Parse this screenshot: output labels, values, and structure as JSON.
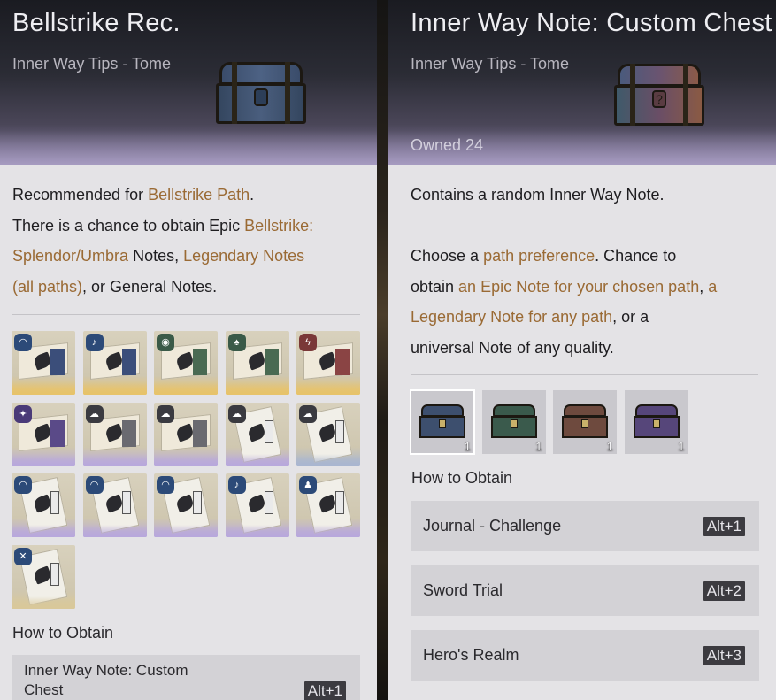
{
  "left_panel": {
    "title": "Bellstrike Rec.",
    "subtitle": "Inner Way Tips - Tome",
    "description": {
      "line1_prefix": "Recommended for ",
      "line1_highlight": "Bellstrike Path",
      "line1_suffix": ".",
      "line2_prefix": "There is a chance to obtain Epic ",
      "line2_highlight": "Bellstrike:",
      "line3_highlight": "Splendor/Umbra",
      "line3_mid": " Notes, ",
      "line3_highlight2": "Legendary Notes",
      "line4_highlight": "(all paths)",
      "line4_suffix": ", or General Notes."
    },
    "note_icons": [
      {
        "icon": "wave-badge-note-icon",
        "badge": "◠",
        "badge_color": "#2c4a78",
        "strip_color": "#3b4e7a",
        "glow": "#e7c36a",
        "style": "scroll"
      },
      {
        "icon": "swirl-badge-note-icon",
        "badge": "♪",
        "badge_color": "#2c4a78",
        "strip_color": "#3b4e7a",
        "glow": "#e7c36a",
        "style": "scroll"
      },
      {
        "icon": "seal-badge-note-icon",
        "badge": "◉",
        "badge_color": "#3a5a48",
        "strip_color": "#4a6a52",
        "glow": "#e7c36a",
        "style": "scroll"
      },
      {
        "icon": "drop-badge-note-icon",
        "badge": "♠",
        "badge_color": "#3a5a48",
        "strip_color": "#4a6a52",
        "glow": "#e7c36a",
        "style": "scroll"
      },
      {
        "icon": "bolt-badge-note-icon",
        "badge": "ϟ",
        "badge_color": "#7a3838",
        "strip_color": "#8a4444",
        "glow": "#e7c36a",
        "style": "scroll"
      },
      {
        "icon": "flame-badge-note-icon",
        "badge": "✦",
        "badge_color": "#4a3a78",
        "strip_color": "#5a4a88",
        "glow": "#b8a8dc",
        "style": "scroll"
      },
      {
        "icon": "cloud-badge-note-icon",
        "badge": "☁",
        "badge_color": "#3a3a40",
        "strip_color": "#6a6a70",
        "glow": "#b8a8dc",
        "style": "scroll"
      },
      {
        "icon": "cloud-badge-note-icon",
        "badge": "☁",
        "badge_color": "#3a3a40",
        "strip_color": "#6a6a70",
        "glow": "#b8a8dc",
        "style": "scroll"
      },
      {
        "icon": "question-note-icon",
        "badge": "☁",
        "badge_color": "#3a3a40",
        "strip_color": "#6a6a70",
        "glow": "#b8a8dc",
        "style": "book"
      },
      {
        "icon": "question-card-note-icon",
        "badge": "☁",
        "badge_color": "#3a3a40",
        "strip_color": "#6a6a70",
        "glow": "#a9b6d0",
        "style": "book"
      },
      {
        "icon": "wave-book-note-icon",
        "badge": "◠",
        "badge_color": "#2c4a78",
        "strip_color": "#3b4e7a",
        "glow": "#b8a8dc",
        "style": "book"
      },
      {
        "icon": "rainbow-book-note-icon",
        "badge": "◠",
        "badge_color": "#2c4a78",
        "strip_color": "#3b4e7a",
        "glow": "#b8a8dc",
        "style": "book"
      },
      {
        "icon": "rainbow-book-note-icon",
        "badge": "◠",
        "badge_color": "#2c4a78",
        "strip_color": "#3b4e7a",
        "glow": "#b8a8dc",
        "style": "book"
      },
      {
        "icon": "drop-book-note-icon",
        "badge": "♪",
        "badge_color": "#2c4a78",
        "strip_color": "#3b4e7a",
        "glow": "#b8a8dc",
        "style": "book"
      },
      {
        "icon": "figure-book-note-icon",
        "badge": "♟",
        "badge_color": "#2c4a78",
        "strip_color": "#3b4e7a",
        "glow": "#b8a8dc",
        "style": "book"
      },
      {
        "icon": "crossed-swords-book-note-icon",
        "badge": "✕",
        "badge_color": "#2c4a78",
        "strip_color": "#3b4e7a",
        "glow": "#d9c89a",
        "style": "book"
      }
    ],
    "how_to_obtain_label": "How to Obtain",
    "obtain": [
      {
        "line1": "Inner Way Note: Custom",
        "line2": "Chest",
        "key": "Alt+1"
      }
    ]
  },
  "right_panel": {
    "title": "Inner Way Note: Custom Chest",
    "subtitle": "Inner Way Tips - Tome",
    "owned": "Owned 24",
    "description": {
      "para1": "Contains a random Inner Way Note.",
      "p2_line1_prefix": "Choose a ",
      "p2_line1_highlight": "path preference",
      "p2_line1_suffix": ". Chance to",
      "p2_line2_prefix": "obtain ",
      "p2_line2_highlight": "an Epic Note for your chosen path",
      "p2_line2_mid": ", ",
      "p2_line2_highlight2": "a",
      "p2_line3_highlight": "Legendary Note for any path",
      "p2_line3_suffix": ", or a",
      "p2_line4": "universal Note of any quality."
    },
    "chests": [
      {
        "qty": "1",
        "color": "#3d4f6e",
        "selected": true
      },
      {
        "qty": "1",
        "color": "#3a5a4c",
        "selected": false
      },
      {
        "qty": "1",
        "color": "#6e4a3e",
        "selected": false
      },
      {
        "qty": "1",
        "color": "#56467a",
        "selected": false
      }
    ],
    "how_to_obtain_label": "How to Obtain",
    "obtain": [
      {
        "name": "Journal - Challenge",
        "key": "Alt+1"
      },
      {
        "name": "Sword Trial",
        "key": "Alt+2"
      },
      {
        "name": "Hero's Realm",
        "key": "Alt+3"
      }
    ]
  },
  "colors": {
    "highlight": "#9a6a34",
    "panel_bg": "#e4e3e6",
    "row_bg": "#d3d2d6",
    "key_bg": "#3c3b40"
  }
}
